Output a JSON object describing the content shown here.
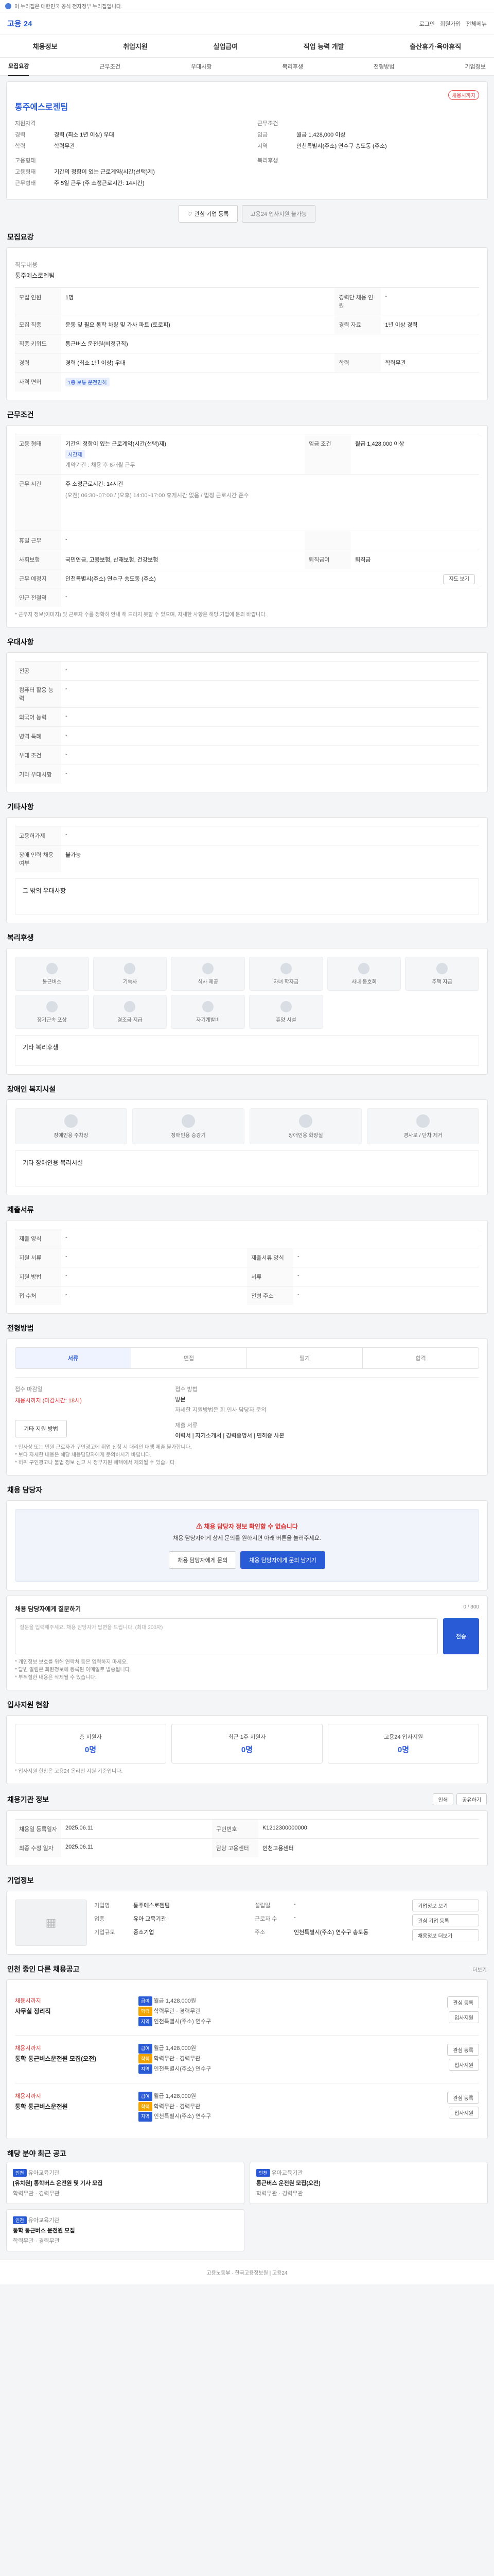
{
  "topbar": {
    "text": "이 누리집은 대한민국 공식 전자정부 누리집입니다."
  },
  "header": {
    "logo_prefix": "고용",
    "logo_main": "24",
    "links": [
      "로그인",
      "회원가입",
      "전체메뉴"
    ]
  },
  "gnb": {
    "items": [
      "채용정보",
      "취업지원",
      "실업급여",
      "직업 능력 개발",
      "출산휴가·육아휴직"
    ]
  },
  "subtabs": {
    "items": [
      "모집요강",
      "근무조건",
      "우대사항",
      "복리후생",
      "전형방법",
      "기업정보"
    ],
    "active": 0
  },
  "summary": {
    "badge": "채용시까지",
    "org": "통주에스로젠팀",
    "left": [
      {
        "k": "지원자격",
        "v": ""
      },
      {
        "k": "경력",
        "v": "경력 (최소 1년 이상) 우대"
      },
      {
        "k": "학력",
        "v": "학력무관"
      },
      {
        "k": "고용형태",
        "v": ""
      },
      {
        "k": "고용형태",
        "v": "기간의 정함이 있는 근로계약(시간(선택)제)"
      },
      {
        "k": "근무형태",
        "v": "주 5일 근무 (주 소정근로시간: 14시간)"
      }
    ],
    "right": [
      {
        "k": "근무조건",
        "v": ""
      },
      {
        "k": "임금",
        "v": "월급 1,428,000 이상"
      },
      {
        "k": "지역",
        "v": "인천특별시(주소) 연수구 송도동 (주소)"
      },
      {
        "k": "복리후생",
        "v": ""
      }
    ],
    "btn_interest": "관심 기업 등록",
    "btn_apply": "고용24 입사지원 불가능"
  },
  "recruit": {
    "title": "모집요강",
    "duty_label": "직무내용",
    "duty": "통주에스로젠팀",
    "rows": [
      {
        "k": "모집 인원",
        "v": "1명",
        "k2": "경력단 채용 인원",
        "v2": "-"
      },
      {
        "k": "모집 직종",
        "v": "운동 및 필요 통학 차량 및 가사 파트 (토로피)",
        "k2": "경력 자료",
        "v2": "1년 이상 경력"
      },
      {
        "k": "직종 키워드",
        "v": "통근버스 운전원(비정규직)",
        "k2": "",
        "v2": ""
      },
      {
        "k": "경력",
        "v": "경력 (최소 1년 이상) 우대",
        "k2": "학력",
        "v2": "학력무관"
      },
      {
        "k": "자격 면허",
        "v": "1종 보통 운전면허",
        "k2": "",
        "v2": ""
      }
    ]
  },
  "conditions": {
    "title": "근무조건",
    "type_k": "고용 형태",
    "type_v": "기간의 정함이 있는 근로계약(시간(선택)제)",
    "type_tag": "시간제",
    "type_sub": "계약기간 : 채용 후 6개월 근무",
    "wage_k": "임금 조건",
    "wage_v": "월급 1,428,000 이상",
    "time_k": "근무 시간",
    "time_week": "주 소정근로시간: 14시간",
    "time_detail": "(오전) 06:30~07:00 / (오후) 14:00~17:00 휴게시간 없음 / 법정 근로시간 준수",
    "holiday_k": "휴일 근무",
    "holiday_v": "-",
    "insurance_k": "사회보험",
    "insurance_v": "국민연금, 고용보험, 산재보험, 건강보험",
    "retire_k": "퇴직급여",
    "retire_v": "퇴직금",
    "place_k": "근무 예정지",
    "place_v": "인천특별시(주소) 연수구 송도동 (주소)",
    "map_btn": "지도 보기",
    "near_k": "인근 전철역",
    "near_v": "-",
    "note": "* 근무지 정보(이미지) 및 근로자 수를 정확히 안내 해 드리지 못할 수 있으며, 자세한 사항은 해당 기업에 문의 바랍니다."
  },
  "preferences": {
    "title": "우대사항",
    "rows": [
      {
        "k": "전공",
        "v": "-"
      },
      {
        "k": "컴퓨터 활용 능력",
        "v": "-"
      },
      {
        "k": "외국어 능력",
        "v": "-"
      },
      {
        "k": "병역 특례",
        "v": "-"
      },
      {
        "k": "우대 조건",
        "v": "-"
      },
      {
        "k": "기타 우대사항",
        "v": "-"
      }
    ]
  },
  "etc": {
    "title": "기타사항",
    "rows": [
      {
        "k": "고용허가제",
        "v": "-"
      },
      {
        "k": "장애 인력 채용 여부",
        "v": "불가능"
      }
    ],
    "note": "그 밖의 우대사항"
  },
  "welfare": {
    "title": "복리후생",
    "items": [
      "통근버스",
      "기숙사",
      "식사 제공",
      "자녀 학자금",
      "사내 동호회",
      "주택 자금",
      "장기근속 포상",
      "경조금 지급",
      "자기계발비",
      "휴양 시설"
    ],
    "other": "기타 복리후생"
  },
  "disability": {
    "title": "장애인 복지시설",
    "items": [
      "장애인용 주차장",
      "장애인용 승강기",
      "장애인용 화장실",
      "경사로 / 단차 제거"
    ],
    "other": "기타 장애인용 복리시설"
  },
  "application": {
    "title": "제출서류",
    "rows": [
      {
        "k": "제출 양식",
        "v": "-",
        "k2": "",
        "v2": ""
      },
      {
        "k": "지원 서류",
        "v": "-",
        "k2": "제출서류 양식",
        "v2": "-"
      },
      {
        "k": "지원 방법",
        "v": "-",
        "k2": "서류",
        "v2": "-"
      },
      {
        "k": "접 수처",
        "v": "-",
        "k2": "전형 주소",
        "v2": "-"
      }
    ]
  },
  "selection": {
    "title": "전형방법",
    "steps": [
      "서류",
      "면접",
      "필기",
      "합격"
    ],
    "deadline_k": "접수 마감일",
    "deadline_v": "채용시까지 (마감시간: 18시)",
    "method_k": "접수 방법",
    "method_v": "방문",
    "method_detail": "자세한 지원방법은 회 인사 담당자 문의",
    "docs_k": "제출 서류",
    "docs_v": "이력서 | 자기소개서 | 경력증명서 | 면허증 사본",
    "btn": "기타 지원 방법"
  },
  "notice": {
    "lines": [
      "* 민사상 또는 민원 근로자가 구인광고에 취업 신청 시 대리인 대행 제출 불가합니다.",
      "* 보다 자세한 내용은 해당 채용담당자에게 문의하시기 바랍니다.",
      "* 허위 구인광고나 불법 정보 신고 시 정부지원 혜택에서 제외될 수 있습니다."
    ]
  },
  "contact": {
    "title": "채용 담당자",
    "warn_title": "채용 담당자 정보 확인할 수 없습니다",
    "warn_sub": "채용 담당자에게 상세 문의를 원하시면 아래 버튼을 눌러주세요.",
    "btn1": "채용 담당자에게 문의",
    "btn2": "채용 담당자에게 문의 남기기"
  },
  "inquiry": {
    "title": "채용 담당자에게 질문하기",
    "placeholder": "질문을 입력해주세요. 채용 담당자가 답변을 드립니다. (최대 300자)",
    "counter": "0 / 300",
    "btn": "전송",
    "notes": [
      "* 개인정보 보호를 위해 연락처 등은 입력하지 마세요.",
      "* 답변 알림은 회원정보에 등록된 이메일로 발송됩니다.",
      "* 부적절한 내용은 삭제될 수 있습니다."
    ]
  },
  "stats": {
    "title": "입사지원 현황",
    "items": [
      {
        "label": "총 지원자",
        "value": "0명"
      },
      {
        "label": "최근 1주 지원자",
        "value": "0명"
      },
      {
        "label": "고용24 입사지원",
        "value": "0명"
      }
    ],
    "note": "* 입사지원 현황은 고용24 온라인 지원 기준입니다."
  },
  "job_info": {
    "title": "채용기관 정보",
    "rows": [
      {
        "k": "채용일 등록일자",
        "v": "2025.06.11",
        "k2": "구인번호",
        "v2": "K1212300000000"
      },
      {
        "k": "최종 수정 일자",
        "v": "2025.06.11",
        "k2": "담당 고용센터",
        "v2": "인천고용센터"
      }
    ],
    "print_btn": "인쇄",
    "share_btn": "공유하기"
  },
  "company": {
    "title": "기업정보",
    "rows": [
      {
        "k": "기업명",
        "v": "통주에스로젠팀"
      },
      {
        "k": "업종",
        "v": "유아 교육기관"
      },
      {
        "k": "기업규모",
        "v": "중소기업"
      },
      {
        "k": "설립일",
        "v": "-"
      },
      {
        "k": "근로자 수",
        "v": "-"
      },
      {
        "k": "주소",
        "v": "인천특별시(주소) 연수구 송도동"
      }
    ],
    "btn1": "기업정보 보기",
    "btn2": "관심 기업 등록",
    "btn3": "채용정보 더보기"
  },
  "similar": {
    "title": "인천 중인 다른 채용공고",
    "more": "더보기",
    "jobs": [
      {
        "badge": "채용시까지",
        "name": "사무실 정리직",
        "wage": "월급 1,428,000원",
        "edu": "학력무관",
        "career": "경력무관",
        "loc": "인천특별시(주소) 연수구",
        "btn1": "관심 등록",
        "btn2": "입사지원"
      },
      {
        "badge": "채용시까지",
        "name": "통학 통근버스운전원 모집(오전)",
        "wage": "월급 1,428,000원",
        "edu": "학력무관",
        "career": "경력무관",
        "loc": "인천특별시(주소) 연수구",
        "btn1": "관심 등록",
        "btn2": "입사지원"
      },
      {
        "badge": "채용시까지",
        "name": "통학 통근버스운전원",
        "wage": "월급 1,428,000원",
        "edu": "학력무관",
        "career": "경력무관",
        "loc": "인천특별시(주소) 연수구",
        "btn1": "관심 등록",
        "btn2": "입사지원"
      }
    ]
  },
  "related": {
    "title": "해당 분야 최근 공고",
    "cards": [
      {
        "tag": "인천",
        "org": "유아교육기관",
        "name": "[유치원] 통학버스 운전원 및 기사 모집",
        "meta": "학력무관 · 경력무관"
      },
      {
        "tag": "인천",
        "org": "유아교육기관",
        "name": "통근버스 운전원 모집(오전)",
        "meta": "학력무관 · 경력무관"
      },
      {
        "tag": "인천",
        "org": "유아교육기관",
        "name": "통학 통근버스 운전원 모집",
        "meta": "학력무관 · 경력무관"
      }
    ]
  },
  "footer": {
    "text": "고용노동부 · 한국고용정보원  |  고용24"
  }
}
